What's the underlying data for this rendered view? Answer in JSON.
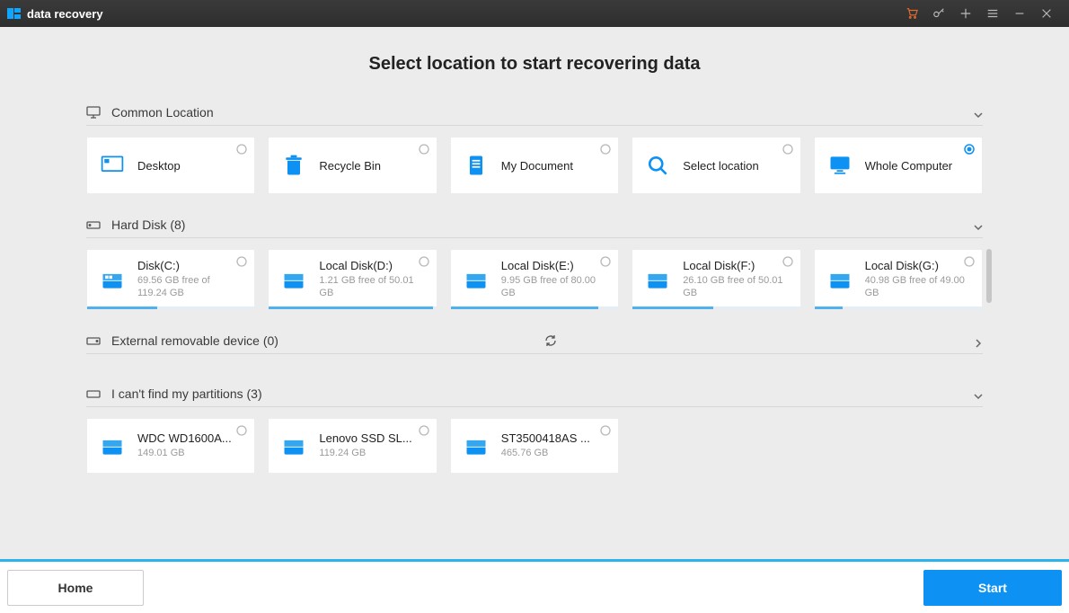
{
  "app": {
    "title": "data recovery"
  },
  "heading": "Select location to start recovering data",
  "sections": {
    "common": {
      "label": "Common Location",
      "selected_index": 4,
      "items": [
        {
          "label": "Desktop"
        },
        {
          "label": "Recycle Bin"
        },
        {
          "label": "My Document"
        },
        {
          "label": "Select location"
        },
        {
          "label": "Whole Computer"
        }
      ]
    },
    "harddisk": {
      "label": "Hard Disk (8)",
      "items": [
        {
          "label": "Disk(C:)",
          "sub": "69.56 GB  free of 119.24 GB",
          "pct": 42
        },
        {
          "label": "Local Disk(D:)",
          "sub": "1.21 GB  free of 50.01 GB",
          "pct": 98
        },
        {
          "label": "Local Disk(E:)",
          "sub": "9.95 GB  free of 80.00 GB",
          "pct": 88
        },
        {
          "label": "Local Disk(F:)",
          "sub": "26.10 GB  free of 50.01 GB",
          "pct": 48
        },
        {
          "label": "Local Disk(G:)",
          "sub": "40.98 GB  free of 49.00 GB",
          "pct": 17
        }
      ]
    },
    "external": {
      "label": "External removable device (0)"
    },
    "cantfind": {
      "label": "I can't find my partitions (3)",
      "items": [
        {
          "label": "WDC WD1600A...",
          "sub": "149.01 GB"
        },
        {
          "label": "Lenovo SSD SL...",
          "sub": "119.24 GB"
        },
        {
          "label": "ST3500418AS ...",
          "sub": "465.76 GB"
        }
      ]
    }
  },
  "footer": {
    "home": "Home",
    "start": "Start"
  }
}
